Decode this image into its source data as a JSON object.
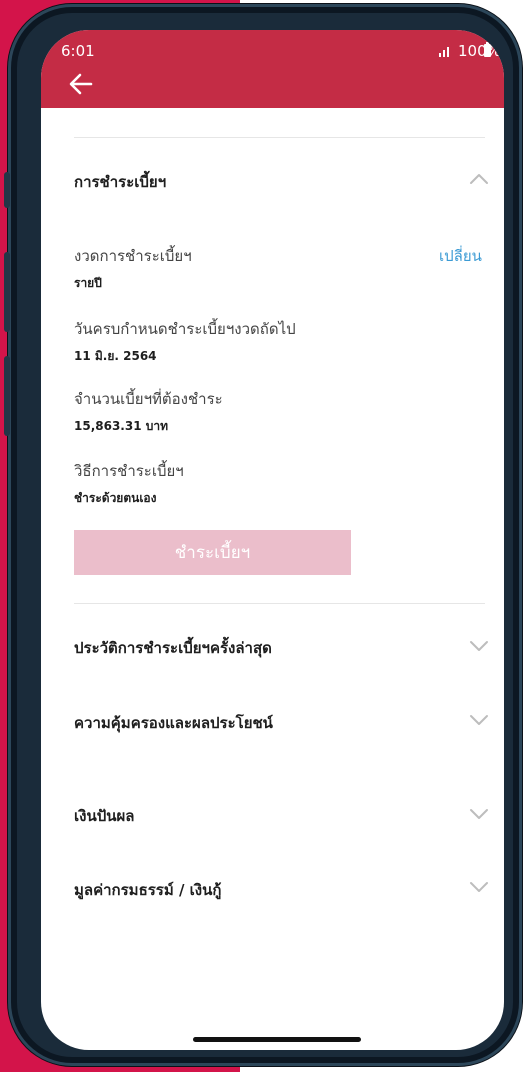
{
  "status_bar": {
    "time": "6:01",
    "battery": "100%"
  },
  "payment_section": {
    "title": "การชำระเบี้ยฯ",
    "period_label": "งวดการชำระเบี้ยฯ",
    "period_value": "รายปี",
    "change_link": "เปลี่ยน",
    "due_label": "วันครบกำหนดชำระเบี้ยฯงวดถัดไป",
    "due_value": "11 มิ.ย. 2564",
    "amount_label": "จำนวนเบี้ยฯที่ต้องชำระ",
    "amount_value": "15,863.31 บาท",
    "method_label": "วิธีการชำระเบี้ยฯ",
    "method_value": "ชำระด้วยตนเอง",
    "pay_button": "ชำระเบี้ยฯ"
  },
  "sections": [
    {
      "title": "ประวัติการชำระเบี้ยฯครั้งล่าสุด"
    },
    {
      "title": "ความคุ้มครองและผลประโยชน์"
    },
    {
      "title": "เงินปันผล"
    },
    {
      "title": "มูลค่ากรมธรรม์ / เงินกู้"
    }
  ],
  "colors": {
    "header": "#c42c45",
    "background_accent": "#d3144a",
    "link": "#3c9bd4",
    "pay_button_disabled": "#ebbecb"
  },
  "icons": {
    "back": "arrow-left-icon",
    "collapse": "chevron-up-icon",
    "expand": "chevron-down-icon",
    "signal": "signal-icon",
    "battery": "battery-icon"
  }
}
